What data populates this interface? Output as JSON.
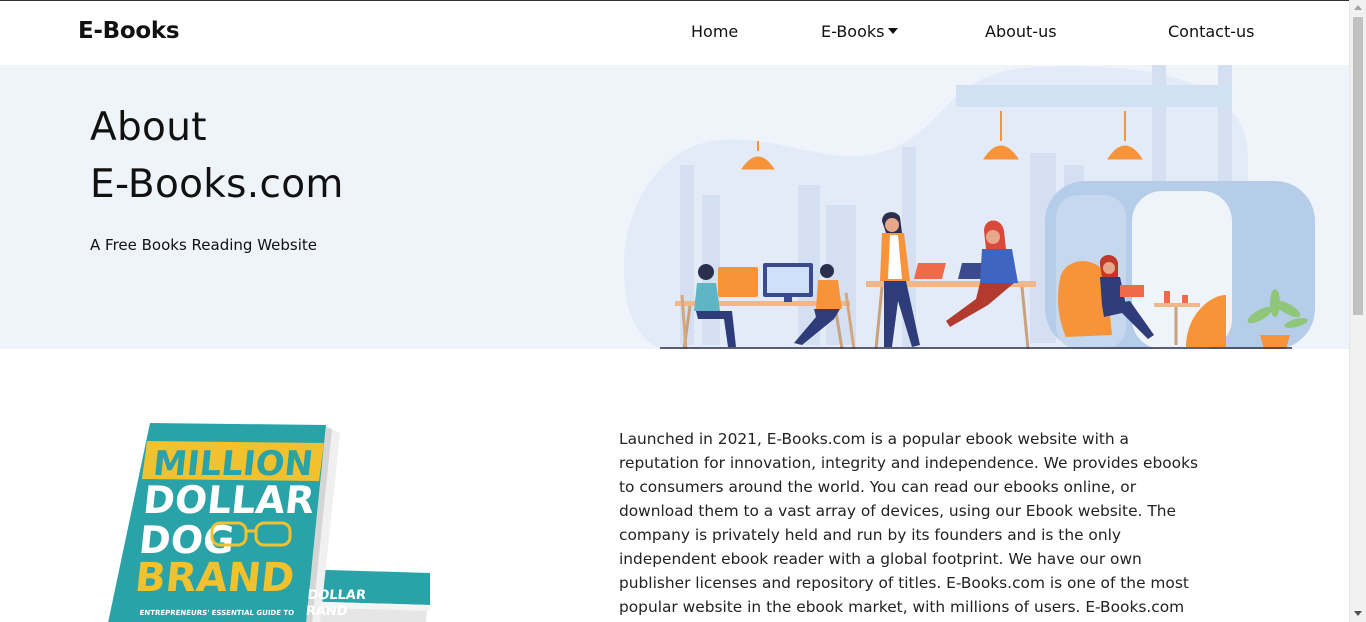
{
  "navbar": {
    "brand": "E-Books",
    "links": {
      "home": "Home",
      "ebooks": "E-Books",
      "about": "About-us",
      "contact": "Contact-us"
    }
  },
  "hero": {
    "title_line1": "About",
    "title_line2": "E-Books.com",
    "subtitle": "A Free Books Reading Website"
  },
  "book_cover": {
    "title_words": [
      "MILLION",
      "DOLLAR",
      "DOG",
      "BRAND"
    ],
    "spine_text": [
      "DOLLAR",
      "RAND"
    ],
    "tagline": "ENTREPRENEURS' ESSENTIAL GUIDE TO"
  },
  "about": {
    "paragraph": "Launched in 2021, E-Books.com is a popular ebook website with a reputation for innovation, integrity and independence. We provides ebooks to consumers around the world. You can read our ebooks online, or download them to a vast array of devices, using our Ebook website. The company is privately held and run by its founders and is the only independent ebook reader with a global footprint. We have our own publisher licenses and repository of titles. E-Books.com is one of the most popular website in the ebook market, with millions of users. E-Books.com hosts over a million unique ebook titles. In"
  },
  "colors": {
    "hero_bg": "#eef4f9",
    "accent_orange": "#f7943a",
    "book_teal": "#2aa3a8",
    "book_yellow": "#f2c12e"
  },
  "icons": {
    "dropdown": "caret-down-icon",
    "scroll_up": "arrow-up-icon",
    "scroll_down": "arrow-down-icon"
  }
}
